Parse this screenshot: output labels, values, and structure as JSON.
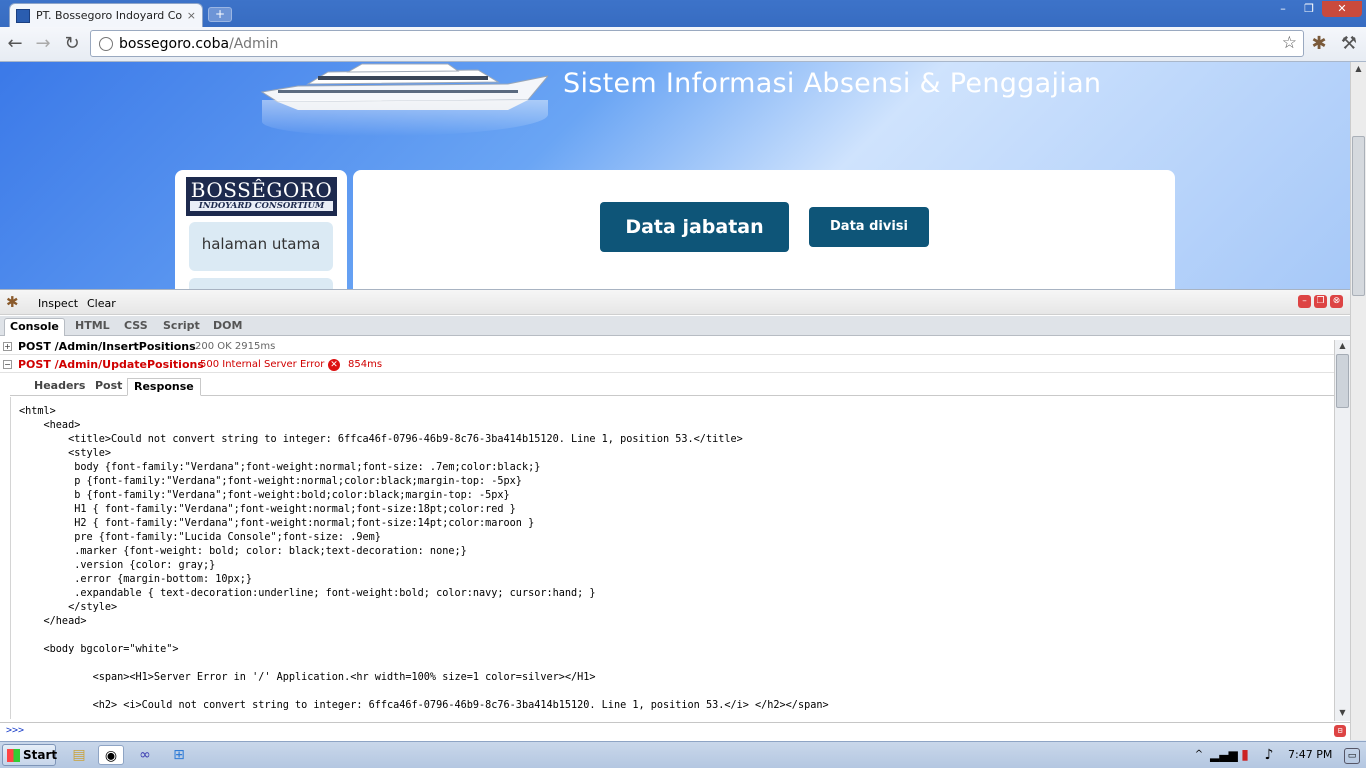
{
  "browser": {
    "tab_title": "PT. Bossegoro Indoyard Consortium",
    "tab_close": "×",
    "new_tab": "+",
    "url_host": "bossegoro.coba",
    "url_path": "/Admin",
    "window_buttons": [
      "–",
      "❐",
      "✕"
    ]
  },
  "site": {
    "title": "Sistem Informasi Absensi & Penggajian",
    "logo_line1": "BOSSÊGORO",
    "logo_line2": "INDOYARD CONSORTIUM",
    "sidebar_items": [
      {
        "label": "halaman utama"
      },
      {
        "label": ""
      }
    ],
    "buttons": {
      "data_jabatan": "Data jabatan",
      "data_divisi": "Data divisi"
    }
  },
  "firebug": {
    "toolbar": {
      "inspect": "Inspect",
      "clear": "Clear"
    },
    "tabs": [
      "Console",
      "HTML",
      "CSS",
      "Script",
      "DOM"
    ],
    "active_tab": "Console",
    "requests": [
      {
        "toggle": "+",
        "method": "POST /Admin/InsertPositions",
        "status": "200 OK 2915ms",
        "error": false
      },
      {
        "toggle": "−",
        "method": "POST /Admin/UpdatePositions",
        "status": "500 Internal Server Error",
        "time": "854ms",
        "error": true
      }
    ],
    "subtabs": [
      "Headers",
      "Post",
      "Response"
    ],
    "response_lines": [
      "<html>",
      "    <head>",
      "        <title>Could not convert string to integer: 6ffca46f-0796-46b9-8c76-3ba414b15120. Line 1, position 53.</title>",
      "        <style>",
      "         body {font-family:\"Verdana\";font-weight:normal;font-size: .7em;color:black;}",
      "         p {font-family:\"Verdana\";font-weight:normal;color:black;margin-top: -5px}",
      "         b {font-family:\"Verdana\";font-weight:bold;color:black;margin-top: -5px}",
      "         H1 { font-family:\"Verdana\";font-weight:normal;font-size:18pt;color:red }",
      "         H2 { font-family:\"Verdana\";font-weight:normal;font-size:14pt;color:maroon }",
      "         pre {font-family:\"Lucida Console\";font-size: .9em}",
      "         .marker {font-weight: bold; color: black;text-decoration: none;}",
      "         .version {color: gray;}",
      "         .error {margin-bottom: 10px;}",
      "         .expandable { text-decoration:underline; font-weight:bold; color:navy; cursor:hand; }",
      "        </style>",
      "    </head>",
      "",
      "    <body bgcolor=\"white\">",
      "",
      "            <span><H1>Server Error in '/' Application.<hr width=100% size=1 color=silver></H1>",
      "",
      "            <h2> <i>Could not convert string to integer: 6ffca46f-0796-46b9-8c76-3ba414b15120. Line 1, position 53.</i> </h2></span>"
    ],
    "command_prompt": ">>>"
  },
  "taskbar": {
    "start_label": "Start",
    "clock": "7:47 PM"
  },
  "colors": {
    "accent_button": "#0e5578",
    "error_red": "#d00000"
  }
}
